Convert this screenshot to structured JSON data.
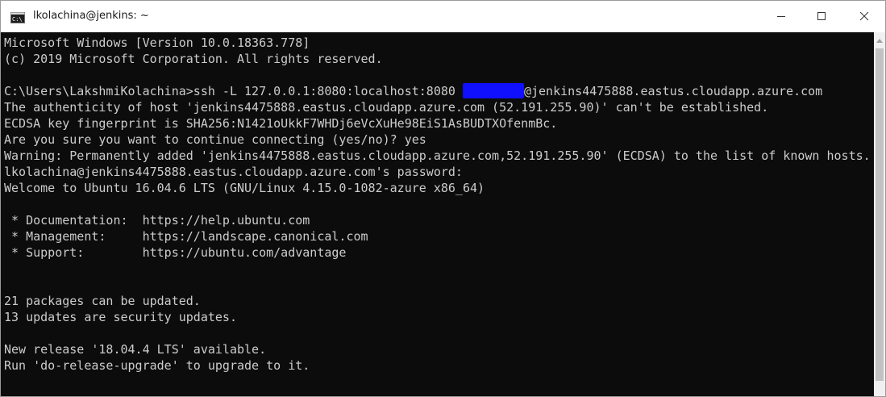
{
  "window": {
    "title": "lkolachina@jenkins: ~"
  },
  "icons": {
    "app": "console-icon",
    "minimize": "minimize-icon",
    "maximize": "maximize-icon",
    "close": "close-icon",
    "scroll_up": "arrow-up-icon"
  },
  "colors": {
    "console_bg": "#0c0c0c",
    "console_text": "#cccccc",
    "redaction": "#1010ff"
  },
  "console": {
    "lines": [
      "Microsoft Windows [Version 10.0.18363.778]",
      "(c) 2019 Microsoft Corporation. All rights reserved.",
      "",
      "C:\\Users\\LakshmiKolachina>ssh -L 127.0.0.1:8080:localhost:8080 ",
      "The authenticity of host 'jenkins4475888.eastus.cloudapp.azure.com (52.191.255.90)' can't be established.",
      "ECDSA key fingerprint is SHA256:N1421oUkkF7WHDj6eVcXuHe98EiS1AsBUDTXOfenmBc.",
      "Are you sure you want to continue connecting (yes/no)? yes",
      "Warning: Permanently added 'jenkins4475888.eastus.cloudapp.azure.com,52.191.255.90' (ECDSA) to the list of known hosts.",
      "lkolachina@jenkins4475888.eastus.cloudapp.azure.com's password:",
      "Welcome to Ubuntu 16.04.6 LTS (GNU/Linux 4.15.0-1082-azure x86_64)",
      "",
      " * Documentation:  https://help.ubuntu.com",
      " * Management:     https://landscape.canonical.com",
      " * Support:        https://ubuntu.com/advantage",
      "",
      "",
      "21 packages can be updated.",
      "13 updates are security updates.",
      "",
      "New release '18.04.4 LTS' available.",
      "Run 'do-release-upgrade' to upgrade to it."
    ],
    "ssh_host_suffix": "@jenkins4475888.eastus.cloudapp.azure.com"
  }
}
